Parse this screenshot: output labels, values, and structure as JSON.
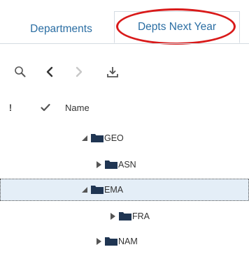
{
  "tabs": [
    {
      "label": "Departments"
    },
    {
      "label": "Depts Next Year"
    }
  ],
  "toolbar": {
    "search": "search-icon",
    "back": "chevron-left-icon",
    "forward": "chevron-right-icon",
    "export": "export-icon"
  },
  "grid": {
    "header": {
      "flag": "!",
      "name": "Name"
    },
    "rows": [
      {
        "label": "GEO",
        "expanded": true
      },
      {
        "label": "ASN",
        "expanded": false
      },
      {
        "label": "EMA",
        "expanded": true
      },
      {
        "label": "FRA",
        "expanded": false
      },
      {
        "label": "NAM",
        "expanded": false
      }
    ]
  },
  "colors": {
    "tab_text": "#2b6ea3",
    "annotation": "#d91a1a",
    "selected_row": "#e4eef7",
    "folder": "#1f3552"
  }
}
